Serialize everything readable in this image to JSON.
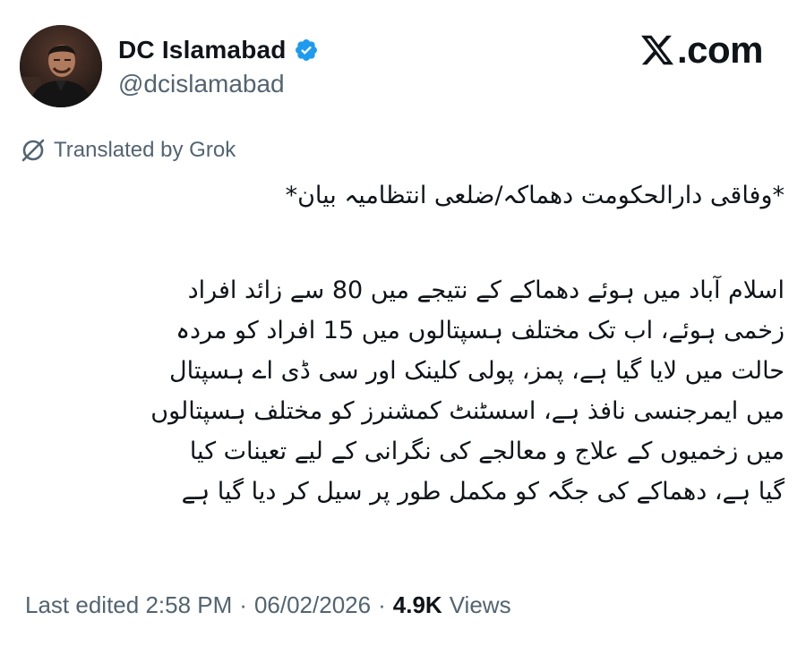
{
  "author": {
    "display_name": "DC Islamabad",
    "handle": "@dcislamabad",
    "verified": true,
    "avatar_icon": "profile-photo"
  },
  "brand": {
    "label": ".com",
    "logo_icon": "x-logo-icon"
  },
  "translation": {
    "label": "Translated by Grok",
    "icon": "grok-icon"
  },
  "post": {
    "headline": "*وفاقی دارالحکومت دھماکہ/ضلعی انتظامیہ بیان*",
    "body_lines": [
      "اسلام آباد میں ہوئے دھماکے کے نتیجے میں 80 سے زائد افراد",
      "زخمی ہوئے، اب تک مختلف ہسپتالوں میں 15 افراد کو مردہ",
      "حالت میں لایا گیا ہے، پمز، پولی کلینک اور سی ڈی اے ہسپتال",
      "میں ایمرجنسی نافذ ہے، اسسٹنٹ کمشنرز کو مختلف ہسپتالوں",
      "میں زخمیوں کے علاج و معالجے کی نگرانی کے لیے تعینات کیا",
      "گیا ہے، دھماکے کی جگہ کو مکمل طور پر سیل کر دیا گیا ہے"
    ]
  },
  "meta": {
    "edited_label": "Last edited",
    "time": "2:58 PM",
    "date": "06/02/2026",
    "separator": "·",
    "views_count": "4.9K",
    "views_label": "Views"
  },
  "colors": {
    "text_primary": "#0f1419",
    "text_secondary": "#536471",
    "verified_blue": "#1d9bf0"
  }
}
